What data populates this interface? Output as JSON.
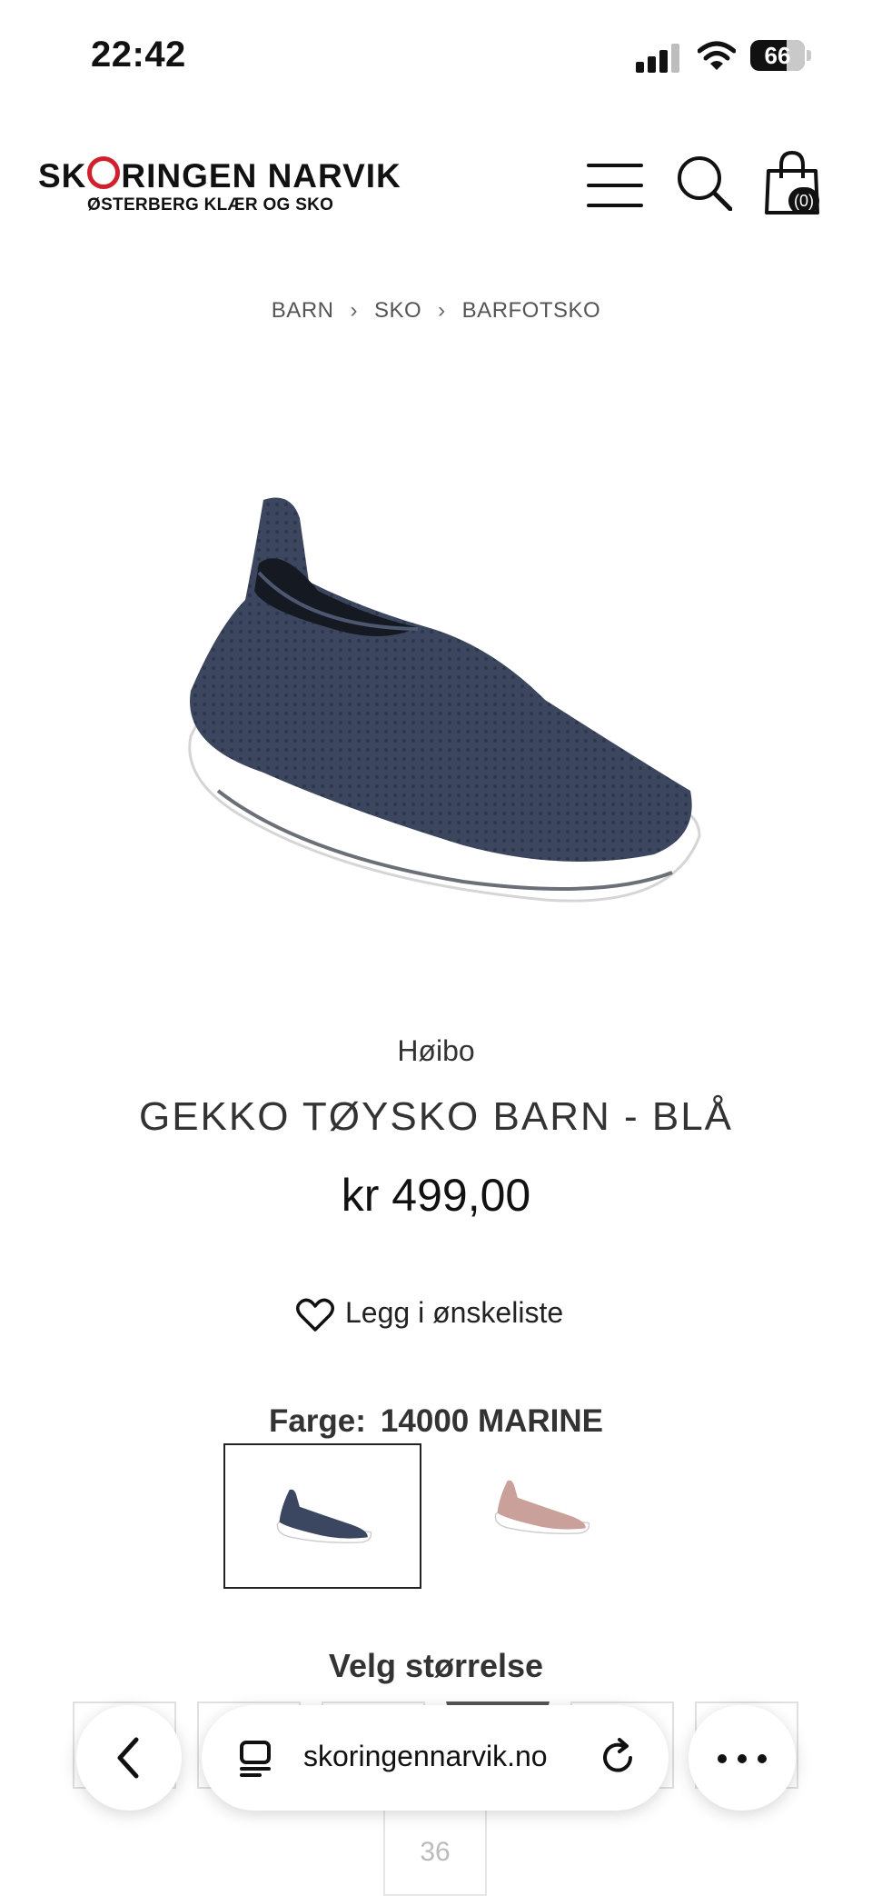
{
  "status_bar": {
    "time": "22:42",
    "battery": "66",
    "signal_icon": "cellular-signal-icon",
    "wifi_icon": "wifi-icon"
  },
  "header": {
    "logo": {
      "part1": "SK",
      "part2": "RINGEN NARVIK",
      "subtitle": "ØSTERBERG KLÆR OG SKO"
    },
    "accent_color": "#d0202d",
    "cart_count": "(0)",
    "icons": [
      "menu-icon",
      "search-icon",
      "shopping-bag-icon"
    ]
  },
  "breadcrumb": [
    "BARN",
    "SKO",
    "BARFOTSKO"
  ],
  "product": {
    "brand": "Høibo",
    "title": "GEKKO TØYSKO BARN - BLÅ",
    "price": "kr 499,00",
    "wishlist_label": "Legg i ønskeliste",
    "color_label": "Farge:",
    "color_value": "14000 MARINE",
    "swatch_colors": [
      "#3b4660",
      "#caa09a"
    ],
    "size_heading": "Velg størrelse",
    "size_partial": "36"
  },
  "browser": {
    "url": "skoringennarvik.no",
    "icons": [
      "back-chevron-icon",
      "tabs-icon",
      "reload-icon",
      "more-icon"
    ]
  }
}
